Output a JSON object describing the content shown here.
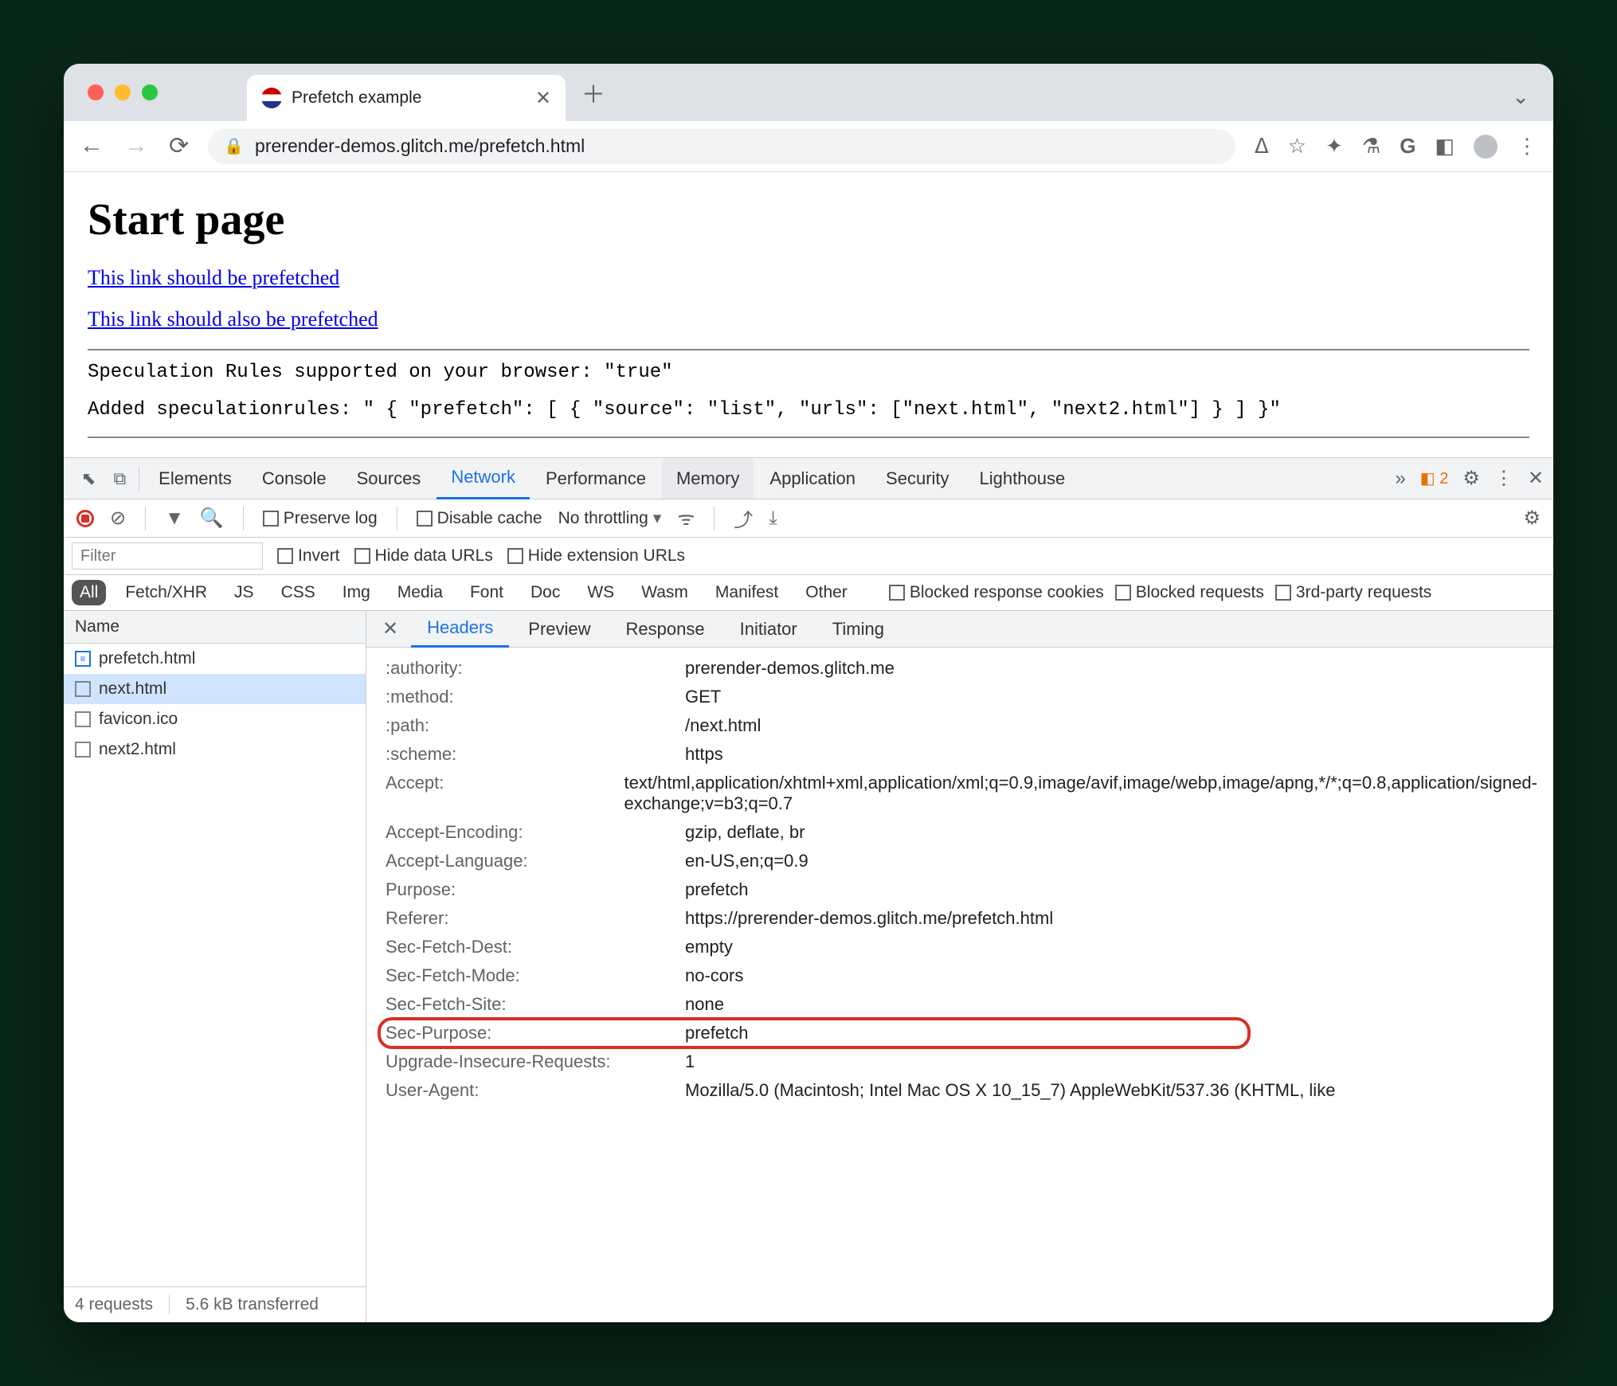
{
  "browser": {
    "tab_title": "Prefetch example",
    "url": "prerender-demos.glitch.me/prefetch.html"
  },
  "page": {
    "heading": "Start page",
    "link1": "This link should be prefetched",
    "link2": "This link should also be prefetched",
    "line1": "Speculation Rules supported on your browser: \"true\"",
    "line2": "Added speculationrules: \" { \"prefetch\": [ { \"source\": \"list\", \"urls\": [\"next.html\", \"next2.html\"] } ] }\""
  },
  "devtools": {
    "tabs": [
      "Elements",
      "Console",
      "Sources",
      "Network",
      "Performance",
      "Memory",
      "Application",
      "Security",
      "Lighthouse"
    ],
    "active_tab": "Network",
    "hover_tab": "Memory",
    "more_indicator": "»",
    "warn_count": "2",
    "toolbar": {
      "preserve_log": "Preserve log",
      "disable_cache": "Disable cache",
      "throttling": "No throttling"
    },
    "filter": {
      "placeholder": "Filter",
      "invert": "Invert",
      "hide_data_urls": "Hide data URLs",
      "hide_ext_urls": "Hide extension URLs"
    },
    "types": [
      "All",
      "Fetch/XHR",
      "JS",
      "CSS",
      "Img",
      "Media",
      "Font",
      "Doc",
      "WS",
      "Wasm",
      "Manifest",
      "Other"
    ],
    "type_checks": {
      "blocked_cookies": "Blocked response cookies",
      "blocked_requests": "Blocked requests",
      "third_party": "3rd-party requests"
    },
    "name_header": "Name",
    "requests": [
      {
        "name": "prefetch.html",
        "icon": "doc",
        "selected": false
      },
      {
        "name": "next.html",
        "icon": "box",
        "selected": true
      },
      {
        "name": "favicon.ico",
        "icon": "box",
        "selected": false
      },
      {
        "name": "next2.html",
        "icon": "box",
        "selected": false
      }
    ],
    "status": {
      "requests": "4 requests",
      "transferred": "5.6 kB transferred"
    },
    "detail_tabs": [
      "Headers",
      "Preview",
      "Response",
      "Initiator",
      "Timing"
    ],
    "detail_active": "Headers",
    "headers": [
      {
        "name": ":authority:",
        "value": "prerender-demos.glitch.me"
      },
      {
        "name": ":method:",
        "value": "GET"
      },
      {
        "name": ":path:",
        "value": "/next.html"
      },
      {
        "name": ":scheme:",
        "value": "https"
      },
      {
        "name": "Accept:",
        "value": "text/html,application/xhtml+xml,application/xml;q=0.9,image/avif,image/webp,image/apng,*/*;q=0.8,application/signed-exchange;v=b3;q=0.7"
      },
      {
        "name": "Accept-Encoding:",
        "value": "gzip, deflate, br"
      },
      {
        "name": "Accept-Language:",
        "value": "en-US,en;q=0.9"
      },
      {
        "name": "Purpose:",
        "value": "prefetch"
      },
      {
        "name": "Referer:",
        "value": "https://prerender-demos.glitch.me/prefetch.html"
      },
      {
        "name": "Sec-Fetch-Dest:",
        "value": "empty"
      },
      {
        "name": "Sec-Fetch-Mode:",
        "value": "no-cors"
      },
      {
        "name": "Sec-Fetch-Site:",
        "value": "none"
      },
      {
        "name": "Sec-Purpose:",
        "value": "prefetch",
        "highlight": true
      },
      {
        "name": "Upgrade-Insecure-Requests:",
        "value": "1"
      },
      {
        "name": "User-Agent:",
        "value": "Mozilla/5.0 (Macintosh; Intel Mac OS X 10_15_7) AppleWebKit/537.36 (KHTML, like"
      }
    ]
  }
}
